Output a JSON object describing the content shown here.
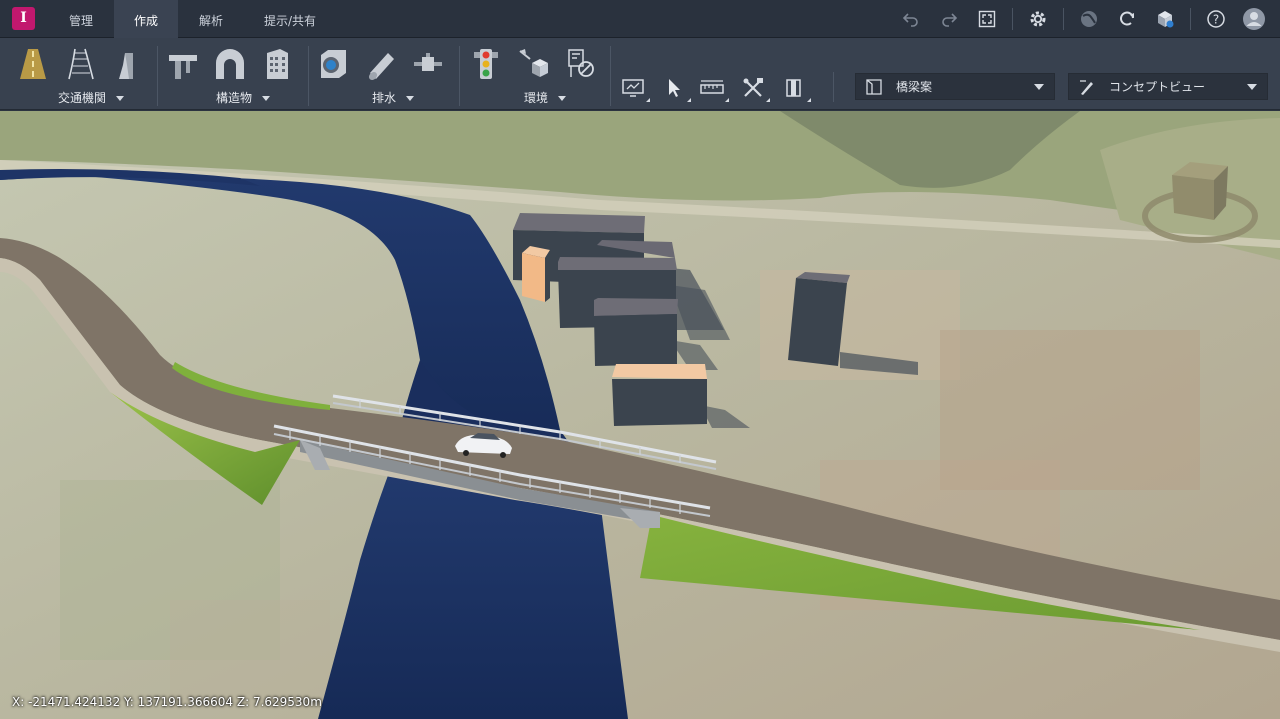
{
  "app": {
    "logo_letter": "I",
    "accent": "#c2186e"
  },
  "tabs": [
    {
      "label": "管理",
      "active": false
    },
    {
      "label": "作成",
      "active": true
    },
    {
      "label": "解析",
      "active": false
    },
    {
      "label": "提示/共有",
      "active": false
    }
  ],
  "top_right_icons": [
    "undo-icon",
    "redo-icon",
    "fit-screen-icon",
    "settings-icon",
    "globe-icon",
    "sync-icon",
    "cube-icon",
    "help-icon",
    "user-icon"
  ],
  "ribbon": {
    "groups": [
      {
        "label": "交通機関",
        "tools": [
          "road-icon",
          "rail-icon",
          "barrier-icon"
        ]
      },
      {
        "label": "構造物",
        "tools": [
          "bridge-icon",
          "tunnel-icon",
          "building-icon"
        ]
      },
      {
        "label": "排水",
        "tools": [
          "culvert-icon",
          "pipe-icon",
          "connector-icon"
        ]
      },
      {
        "label": "環境",
        "tools": [
          "traffic-light-icon",
          "street-light-icon",
          "sign-icon"
        ]
      }
    ],
    "small_tools": [
      "display-icon",
      "select-icon",
      "measure-icon",
      "tools-icon",
      "clip-icon"
    ],
    "proposal_dropdown": {
      "label": "橋梁案",
      "icon": "proposal-icon"
    },
    "view_dropdown": {
      "label": "コンセプトビュー",
      "icon": "pen-icon"
    }
  },
  "viewport": {
    "coords": "X: -21471.424132 Y: 137191.366604 Z: 7.629530m",
    "colors": {
      "water": "#1a2d5a",
      "road": "#7f7467",
      "grass": "#7ba63a",
      "terrain": "#b8b59a"
    }
  }
}
